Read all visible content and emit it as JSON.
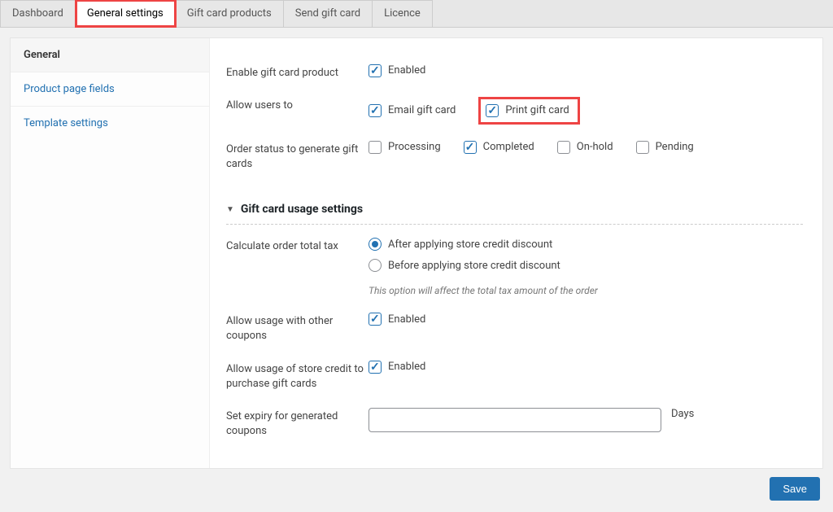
{
  "tabs": [
    {
      "id": "dashboard",
      "label": "Dashboard"
    },
    {
      "id": "general",
      "label": "General settings",
      "active": true,
      "highlighted": true
    },
    {
      "id": "products",
      "label": "Gift card products"
    },
    {
      "id": "send",
      "label": "Send gift card"
    },
    {
      "id": "licence",
      "label": "Licence"
    }
  ],
  "sidebar_items": [
    {
      "id": "general",
      "label": "General",
      "selected": true
    },
    {
      "id": "product_page",
      "label": "Product page fields"
    },
    {
      "id": "template",
      "label": "Template settings"
    }
  ],
  "fields": {
    "enable_label": "Enable gift card product",
    "enable_checkbox": "Enabled",
    "allow_users_label": "Allow users to",
    "email_gift": "Email gift card",
    "print_gift": "Print gift card",
    "order_status_label": "Order status to generate gift cards",
    "status_processing": "Processing",
    "status_completed": "Completed",
    "status_onhold": "On-hold",
    "status_pending": "Pending"
  },
  "section": {
    "title": "Gift card usage settings",
    "calc_label": "Calculate order total tax",
    "calc_after": "After applying store credit discount",
    "calc_before": "Before applying store credit discount",
    "calc_help": "This option will affect the total tax amount of the order",
    "other_coupons_label": "Allow usage with other coupons",
    "other_coupons_enabled": "Enabled",
    "store_credit_label": "Allow usage of store credit to purchase gift cards",
    "store_credit_enabled": "Enabled",
    "expiry_label": "Set expiry for generated coupons",
    "expiry_suffix": "Days"
  },
  "footer": {
    "save": "Save"
  }
}
